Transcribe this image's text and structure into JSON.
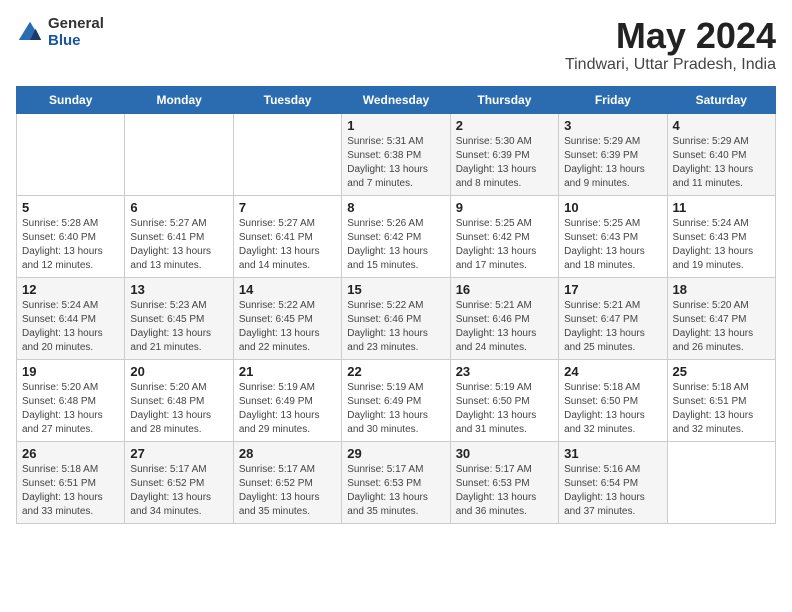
{
  "header": {
    "logo_general": "General",
    "logo_blue": "Blue",
    "month": "May 2024",
    "location": "Tindwari, Uttar Pradesh, India"
  },
  "days_of_week": [
    "Sunday",
    "Monday",
    "Tuesday",
    "Wednesday",
    "Thursday",
    "Friday",
    "Saturday"
  ],
  "weeks": [
    [
      {
        "day": "",
        "sunrise": "",
        "sunset": "",
        "daylight": ""
      },
      {
        "day": "",
        "sunrise": "",
        "sunset": "",
        "daylight": ""
      },
      {
        "day": "",
        "sunrise": "",
        "sunset": "",
        "daylight": ""
      },
      {
        "day": "1",
        "sunrise": "Sunrise: 5:31 AM",
        "sunset": "Sunset: 6:38 PM",
        "daylight": "Daylight: 13 hours and 7 minutes."
      },
      {
        "day": "2",
        "sunrise": "Sunrise: 5:30 AM",
        "sunset": "Sunset: 6:39 PM",
        "daylight": "Daylight: 13 hours and 8 minutes."
      },
      {
        "day": "3",
        "sunrise": "Sunrise: 5:29 AM",
        "sunset": "Sunset: 6:39 PM",
        "daylight": "Daylight: 13 hours and 9 minutes."
      },
      {
        "day": "4",
        "sunrise": "Sunrise: 5:29 AM",
        "sunset": "Sunset: 6:40 PM",
        "daylight": "Daylight: 13 hours and 11 minutes."
      }
    ],
    [
      {
        "day": "5",
        "sunrise": "Sunrise: 5:28 AM",
        "sunset": "Sunset: 6:40 PM",
        "daylight": "Daylight: 13 hours and 12 minutes."
      },
      {
        "day": "6",
        "sunrise": "Sunrise: 5:27 AM",
        "sunset": "Sunset: 6:41 PM",
        "daylight": "Daylight: 13 hours and 13 minutes."
      },
      {
        "day": "7",
        "sunrise": "Sunrise: 5:27 AM",
        "sunset": "Sunset: 6:41 PM",
        "daylight": "Daylight: 13 hours and 14 minutes."
      },
      {
        "day": "8",
        "sunrise": "Sunrise: 5:26 AM",
        "sunset": "Sunset: 6:42 PM",
        "daylight": "Daylight: 13 hours and 15 minutes."
      },
      {
        "day": "9",
        "sunrise": "Sunrise: 5:25 AM",
        "sunset": "Sunset: 6:42 PM",
        "daylight": "Daylight: 13 hours and 17 minutes."
      },
      {
        "day": "10",
        "sunrise": "Sunrise: 5:25 AM",
        "sunset": "Sunset: 6:43 PM",
        "daylight": "Daylight: 13 hours and 18 minutes."
      },
      {
        "day": "11",
        "sunrise": "Sunrise: 5:24 AM",
        "sunset": "Sunset: 6:43 PM",
        "daylight": "Daylight: 13 hours and 19 minutes."
      }
    ],
    [
      {
        "day": "12",
        "sunrise": "Sunrise: 5:24 AM",
        "sunset": "Sunset: 6:44 PM",
        "daylight": "Daylight: 13 hours and 20 minutes."
      },
      {
        "day": "13",
        "sunrise": "Sunrise: 5:23 AM",
        "sunset": "Sunset: 6:45 PM",
        "daylight": "Daylight: 13 hours and 21 minutes."
      },
      {
        "day": "14",
        "sunrise": "Sunrise: 5:22 AM",
        "sunset": "Sunset: 6:45 PM",
        "daylight": "Daylight: 13 hours and 22 minutes."
      },
      {
        "day": "15",
        "sunrise": "Sunrise: 5:22 AM",
        "sunset": "Sunset: 6:46 PM",
        "daylight": "Daylight: 13 hours and 23 minutes."
      },
      {
        "day": "16",
        "sunrise": "Sunrise: 5:21 AM",
        "sunset": "Sunset: 6:46 PM",
        "daylight": "Daylight: 13 hours and 24 minutes."
      },
      {
        "day": "17",
        "sunrise": "Sunrise: 5:21 AM",
        "sunset": "Sunset: 6:47 PM",
        "daylight": "Daylight: 13 hours and 25 minutes."
      },
      {
        "day": "18",
        "sunrise": "Sunrise: 5:20 AM",
        "sunset": "Sunset: 6:47 PM",
        "daylight": "Daylight: 13 hours and 26 minutes."
      }
    ],
    [
      {
        "day": "19",
        "sunrise": "Sunrise: 5:20 AM",
        "sunset": "Sunset: 6:48 PM",
        "daylight": "Daylight: 13 hours and 27 minutes."
      },
      {
        "day": "20",
        "sunrise": "Sunrise: 5:20 AM",
        "sunset": "Sunset: 6:48 PM",
        "daylight": "Daylight: 13 hours and 28 minutes."
      },
      {
        "day": "21",
        "sunrise": "Sunrise: 5:19 AM",
        "sunset": "Sunset: 6:49 PM",
        "daylight": "Daylight: 13 hours and 29 minutes."
      },
      {
        "day": "22",
        "sunrise": "Sunrise: 5:19 AM",
        "sunset": "Sunset: 6:49 PM",
        "daylight": "Daylight: 13 hours and 30 minutes."
      },
      {
        "day": "23",
        "sunrise": "Sunrise: 5:19 AM",
        "sunset": "Sunset: 6:50 PM",
        "daylight": "Daylight: 13 hours and 31 minutes."
      },
      {
        "day": "24",
        "sunrise": "Sunrise: 5:18 AM",
        "sunset": "Sunset: 6:50 PM",
        "daylight": "Daylight: 13 hours and 32 minutes."
      },
      {
        "day": "25",
        "sunrise": "Sunrise: 5:18 AM",
        "sunset": "Sunset: 6:51 PM",
        "daylight": "Daylight: 13 hours and 32 minutes."
      }
    ],
    [
      {
        "day": "26",
        "sunrise": "Sunrise: 5:18 AM",
        "sunset": "Sunset: 6:51 PM",
        "daylight": "Daylight: 13 hours and 33 minutes."
      },
      {
        "day": "27",
        "sunrise": "Sunrise: 5:17 AM",
        "sunset": "Sunset: 6:52 PM",
        "daylight": "Daylight: 13 hours and 34 minutes."
      },
      {
        "day": "28",
        "sunrise": "Sunrise: 5:17 AM",
        "sunset": "Sunset: 6:52 PM",
        "daylight": "Daylight: 13 hours and 35 minutes."
      },
      {
        "day": "29",
        "sunrise": "Sunrise: 5:17 AM",
        "sunset": "Sunset: 6:53 PM",
        "daylight": "Daylight: 13 hours and 35 minutes."
      },
      {
        "day": "30",
        "sunrise": "Sunrise: 5:17 AM",
        "sunset": "Sunset: 6:53 PM",
        "daylight": "Daylight: 13 hours and 36 minutes."
      },
      {
        "day": "31",
        "sunrise": "Sunrise: 5:16 AM",
        "sunset": "Sunset: 6:54 PM",
        "daylight": "Daylight: 13 hours and 37 minutes."
      },
      {
        "day": "",
        "sunrise": "",
        "sunset": "",
        "daylight": ""
      }
    ]
  ]
}
